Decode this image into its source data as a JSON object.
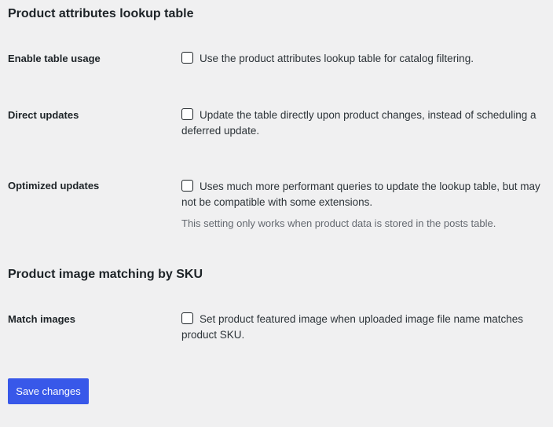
{
  "sections": {
    "lookup_title": "Product attributes lookup table",
    "image_title": "Product image matching by SKU"
  },
  "rows": {
    "enable_table": {
      "label": "Enable table usage",
      "text": "Use the product attributes lookup table for catalog filtering.",
      "checked": false
    },
    "direct_updates": {
      "label": "Direct updates",
      "text": "Update the table directly upon product changes, instead of scheduling a deferred update.",
      "checked": false
    },
    "optimized_updates": {
      "label": "Optimized updates",
      "text": "Uses much more performant queries to update the lookup table, but may not be compatible with some extensions.",
      "description": "This setting only works when product data is stored in the posts table.",
      "checked": false
    },
    "match_images": {
      "label": "Match images",
      "text": "Set product featured image when uploaded image file name matches product SKU.",
      "checked": false
    }
  },
  "actions": {
    "save_label": "Save changes"
  },
  "colors": {
    "background": "#f0f0f1",
    "primary_button": "#3858e9",
    "muted_text": "#646970"
  }
}
